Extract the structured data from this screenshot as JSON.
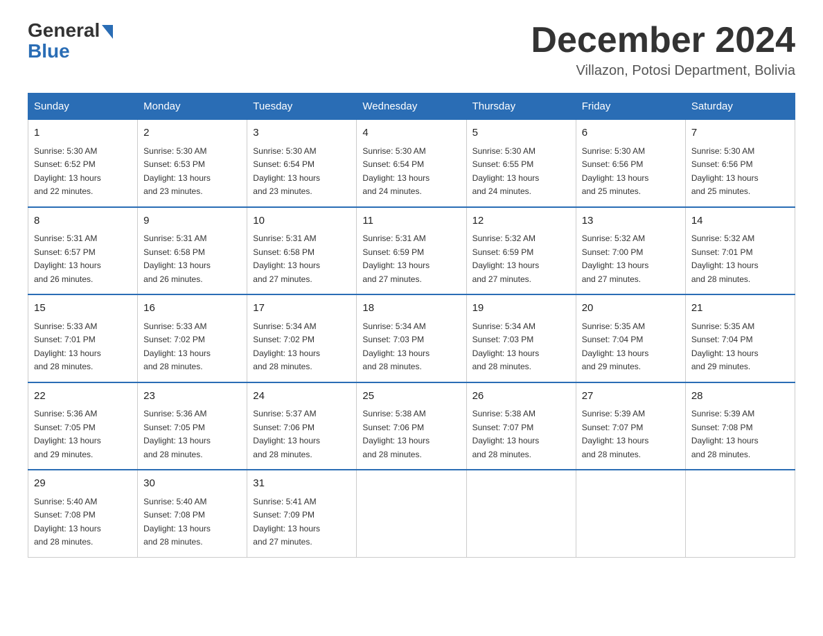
{
  "logo": {
    "general": "General",
    "blue": "Blue"
  },
  "header": {
    "month_year": "December 2024",
    "location": "Villazon, Potosi Department, Bolivia"
  },
  "days_of_week": [
    "Sunday",
    "Monday",
    "Tuesday",
    "Wednesday",
    "Thursday",
    "Friday",
    "Saturday"
  ],
  "weeks": [
    [
      {
        "day": "1",
        "sunrise": "5:30 AM",
        "sunset": "6:52 PM",
        "daylight": "13 hours and 22 minutes."
      },
      {
        "day": "2",
        "sunrise": "5:30 AM",
        "sunset": "6:53 PM",
        "daylight": "13 hours and 23 minutes."
      },
      {
        "day": "3",
        "sunrise": "5:30 AM",
        "sunset": "6:54 PM",
        "daylight": "13 hours and 23 minutes."
      },
      {
        "day": "4",
        "sunrise": "5:30 AM",
        "sunset": "6:54 PM",
        "daylight": "13 hours and 24 minutes."
      },
      {
        "day": "5",
        "sunrise": "5:30 AM",
        "sunset": "6:55 PM",
        "daylight": "13 hours and 24 minutes."
      },
      {
        "day": "6",
        "sunrise": "5:30 AM",
        "sunset": "6:56 PM",
        "daylight": "13 hours and 25 minutes."
      },
      {
        "day": "7",
        "sunrise": "5:30 AM",
        "sunset": "6:56 PM",
        "daylight": "13 hours and 25 minutes."
      }
    ],
    [
      {
        "day": "8",
        "sunrise": "5:31 AM",
        "sunset": "6:57 PM",
        "daylight": "13 hours and 26 minutes."
      },
      {
        "day": "9",
        "sunrise": "5:31 AM",
        "sunset": "6:58 PM",
        "daylight": "13 hours and 26 minutes."
      },
      {
        "day": "10",
        "sunrise": "5:31 AM",
        "sunset": "6:58 PM",
        "daylight": "13 hours and 27 minutes."
      },
      {
        "day": "11",
        "sunrise": "5:31 AM",
        "sunset": "6:59 PM",
        "daylight": "13 hours and 27 minutes."
      },
      {
        "day": "12",
        "sunrise": "5:32 AM",
        "sunset": "6:59 PM",
        "daylight": "13 hours and 27 minutes."
      },
      {
        "day": "13",
        "sunrise": "5:32 AM",
        "sunset": "7:00 PM",
        "daylight": "13 hours and 27 minutes."
      },
      {
        "day": "14",
        "sunrise": "5:32 AM",
        "sunset": "7:01 PM",
        "daylight": "13 hours and 28 minutes."
      }
    ],
    [
      {
        "day": "15",
        "sunrise": "5:33 AM",
        "sunset": "7:01 PM",
        "daylight": "13 hours and 28 minutes."
      },
      {
        "day": "16",
        "sunrise": "5:33 AM",
        "sunset": "7:02 PM",
        "daylight": "13 hours and 28 minutes."
      },
      {
        "day": "17",
        "sunrise": "5:34 AM",
        "sunset": "7:02 PM",
        "daylight": "13 hours and 28 minutes."
      },
      {
        "day": "18",
        "sunrise": "5:34 AM",
        "sunset": "7:03 PM",
        "daylight": "13 hours and 28 minutes."
      },
      {
        "day": "19",
        "sunrise": "5:34 AM",
        "sunset": "7:03 PM",
        "daylight": "13 hours and 28 minutes."
      },
      {
        "day": "20",
        "sunrise": "5:35 AM",
        "sunset": "7:04 PM",
        "daylight": "13 hours and 29 minutes."
      },
      {
        "day": "21",
        "sunrise": "5:35 AM",
        "sunset": "7:04 PM",
        "daylight": "13 hours and 29 minutes."
      }
    ],
    [
      {
        "day": "22",
        "sunrise": "5:36 AM",
        "sunset": "7:05 PM",
        "daylight": "13 hours and 29 minutes."
      },
      {
        "day": "23",
        "sunrise": "5:36 AM",
        "sunset": "7:05 PM",
        "daylight": "13 hours and 28 minutes."
      },
      {
        "day": "24",
        "sunrise": "5:37 AM",
        "sunset": "7:06 PM",
        "daylight": "13 hours and 28 minutes."
      },
      {
        "day": "25",
        "sunrise": "5:38 AM",
        "sunset": "7:06 PM",
        "daylight": "13 hours and 28 minutes."
      },
      {
        "day": "26",
        "sunrise": "5:38 AM",
        "sunset": "7:07 PM",
        "daylight": "13 hours and 28 minutes."
      },
      {
        "day": "27",
        "sunrise": "5:39 AM",
        "sunset": "7:07 PM",
        "daylight": "13 hours and 28 minutes."
      },
      {
        "day": "28",
        "sunrise": "5:39 AM",
        "sunset": "7:08 PM",
        "daylight": "13 hours and 28 minutes."
      }
    ],
    [
      {
        "day": "29",
        "sunrise": "5:40 AM",
        "sunset": "7:08 PM",
        "daylight": "13 hours and 28 minutes."
      },
      {
        "day": "30",
        "sunrise": "5:40 AM",
        "sunset": "7:08 PM",
        "daylight": "13 hours and 28 minutes."
      },
      {
        "day": "31",
        "sunrise": "5:41 AM",
        "sunset": "7:09 PM",
        "daylight": "13 hours and 27 minutes."
      },
      null,
      null,
      null,
      null
    ]
  ],
  "labels": {
    "sunrise": "Sunrise:",
    "sunset": "Sunset:",
    "daylight": "Daylight:"
  }
}
